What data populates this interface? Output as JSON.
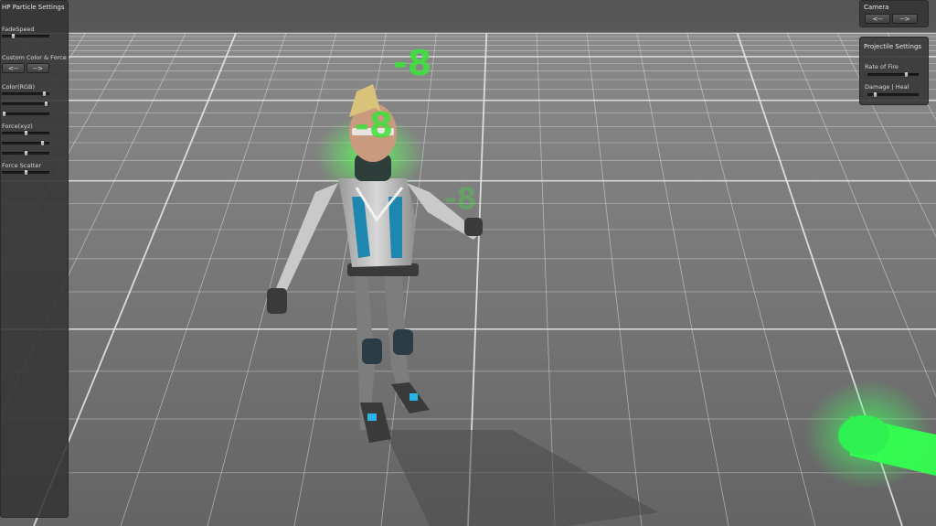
{
  "hp_panel": {
    "title": "HP Particle Settings",
    "fade_speed_label": "FadeSpeed",
    "custom_label": "Custom Color & Force",
    "prev_button": "<--",
    "next_button": "-->",
    "color_label": "Color(RGB)",
    "force_label": "Force(xyz)",
    "scatter_label": "Force Scatter"
  },
  "camera_panel": {
    "title": "Camera",
    "prev_button": "<--",
    "next_button": "-->"
  },
  "projectile_panel": {
    "title": "Projectile Settings",
    "rate_label": "Rate of Fire",
    "damage_label": "Damage | Heal"
  },
  "floating_numbers": [
    "-8",
    "-8",
    "-8"
  ],
  "colors": {
    "heal_green": "#39ff4a",
    "panel": "#353535",
    "floor": "#6b6b6b"
  }
}
